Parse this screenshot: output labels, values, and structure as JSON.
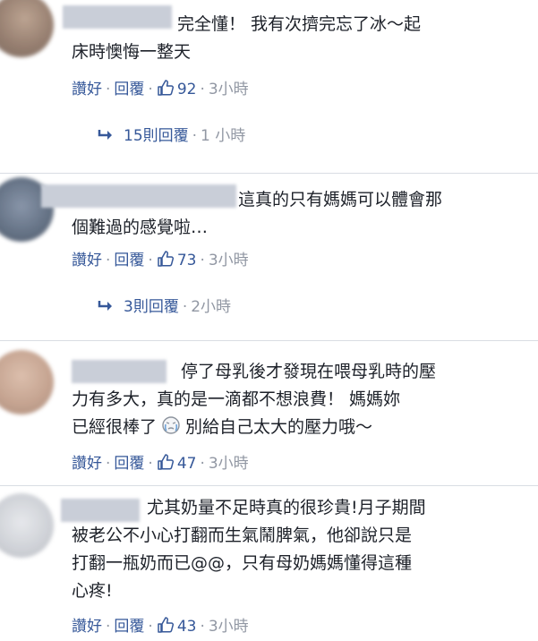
{
  "comments": [
    {
      "lines": [
        "完全懂！ 我有次擠完忘了冰～起",
        "床時懊悔一整天"
      ],
      "like_label": "讚好",
      "reply_label": "回覆",
      "like_count": "92",
      "time": "3小時",
      "replies_label": "15則回覆",
      "replies_time": "1 小時"
    },
    {
      "lines": [
        "這真的只有媽媽可以體會那",
        "個難過的感覺啦…"
      ],
      "like_label": "讚好",
      "reply_label": "回覆",
      "like_count": "73",
      "time": "3小時",
      "replies_label": "3則回覆",
      "replies_time": "2小時"
    },
    {
      "lines": [
        "停了母乳後才發現在喂母乳時的壓",
        "力有多大，真的是一滴都不想浪費！ 媽媽妳",
        "已經很棒了",
        "別給自己太大的壓力哦～"
      ],
      "like_label": "讚好",
      "reply_label": "回覆",
      "like_count": "47",
      "time": "3小時"
    },
    {
      "lines": [
        "尤其奶量不足時真的很珍貴!月子期間",
        "被老公不小心打翻而生氣鬧脾氣，他卻說只是",
        "打翻一瓶奶而已@@，只有母奶媽媽懂得這種",
        "心疼!"
      ],
      "like_label": "讚好",
      "reply_label": "回覆",
      "like_count": "43",
      "time": "3小時"
    }
  ],
  "icons": {
    "like": "thumbs-up-icon",
    "reply": "reply-arrow-icon",
    "emoji": "tears-emoji-icon"
  },
  "colors": {
    "link": "#365899",
    "meta": "#9197a3",
    "text": "#1d2129",
    "divider": "#d9dde3"
  }
}
